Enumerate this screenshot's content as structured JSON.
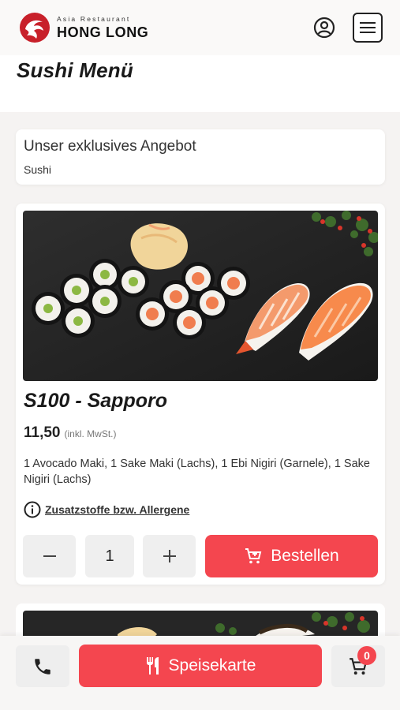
{
  "header": {
    "logo_small": "Asia Restaurant",
    "logo_big": "HONG LONG",
    "user_icon": "user-circle-icon",
    "menu_icon": "hamburger-icon"
  },
  "page": {
    "title": "Sushi Menü"
  },
  "offer": {
    "title": "Unser exklusives Angebot",
    "subtitle": "Sushi"
  },
  "product": {
    "name": "S100 - Sapporo",
    "price": "11,50",
    "price_note": "(inkl. MwSt.)",
    "description": "1 Avocado Maki, 1 Sake Maki (Lachs), 1 Ebi Nigiri (Garnele), 1 Sake Nigiri (Lachs)",
    "allergen_link": "Zusatzstoffe bzw. Allergene",
    "quantity": "1",
    "order_label": "Bestellen"
  },
  "bottom_bar": {
    "menu_label": "Speisekarte",
    "cart_count": "0"
  },
  "colors": {
    "accent": "#f4464f",
    "button_grey": "#efefef"
  }
}
